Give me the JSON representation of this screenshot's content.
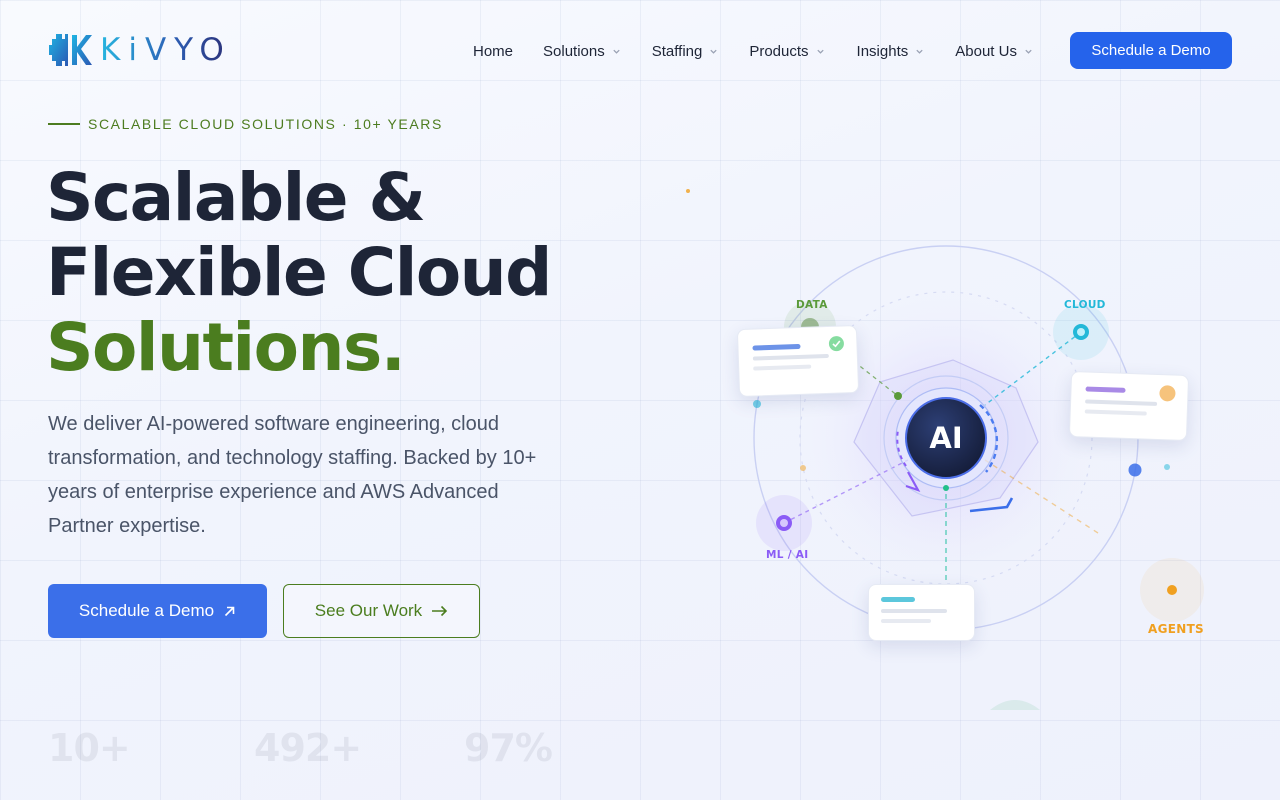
{
  "brand": {
    "name": "KiVYO"
  },
  "nav": {
    "items": [
      {
        "label": "Home",
        "has_dropdown": false
      },
      {
        "label": "Solutions",
        "has_dropdown": true
      },
      {
        "label": "Staffing",
        "has_dropdown": true
      },
      {
        "label": "Products",
        "has_dropdown": true
      },
      {
        "label": "Insights",
        "has_dropdown": true
      },
      {
        "label": "About Us",
        "has_dropdown": true
      }
    ],
    "cta_label": "Schedule a Demo"
  },
  "hero": {
    "eyebrow": "SCALABLE CLOUD SOLUTIONS · 10+ YEARS",
    "headline_line1": "Scalable &",
    "headline_line2": "Flexible Cloud",
    "headline_line3": "Solutions.",
    "lede": "We deliver AI-powered software engineering, cloud transformation, and technology staffing. Backed by 10+ years of enterprise experience and AWS Advanced Partner expertise.",
    "primary_cta": "Schedule a Demo",
    "primary_cta_icon": "arrow-up-right-icon",
    "secondary_cta": "See Our Work",
    "secondary_cta_icon": "arrow-right-icon"
  },
  "visual": {
    "center_label": "AI",
    "nodes": {
      "data": "DATA",
      "cloud": "CLOUD",
      "ml_ai": "ML / AI",
      "agents": "AGENTS"
    }
  },
  "stats": [
    "10+",
    "492+",
    "97%"
  ],
  "colors": {
    "primary": "#2563eb",
    "accent_green": "#4b7d1f",
    "text_dark": "#1e2537",
    "data": "#5a9a3a",
    "cloud": "#22b8d8",
    "ml_ai": "#8b5cf6",
    "agents": "#f0a020"
  }
}
